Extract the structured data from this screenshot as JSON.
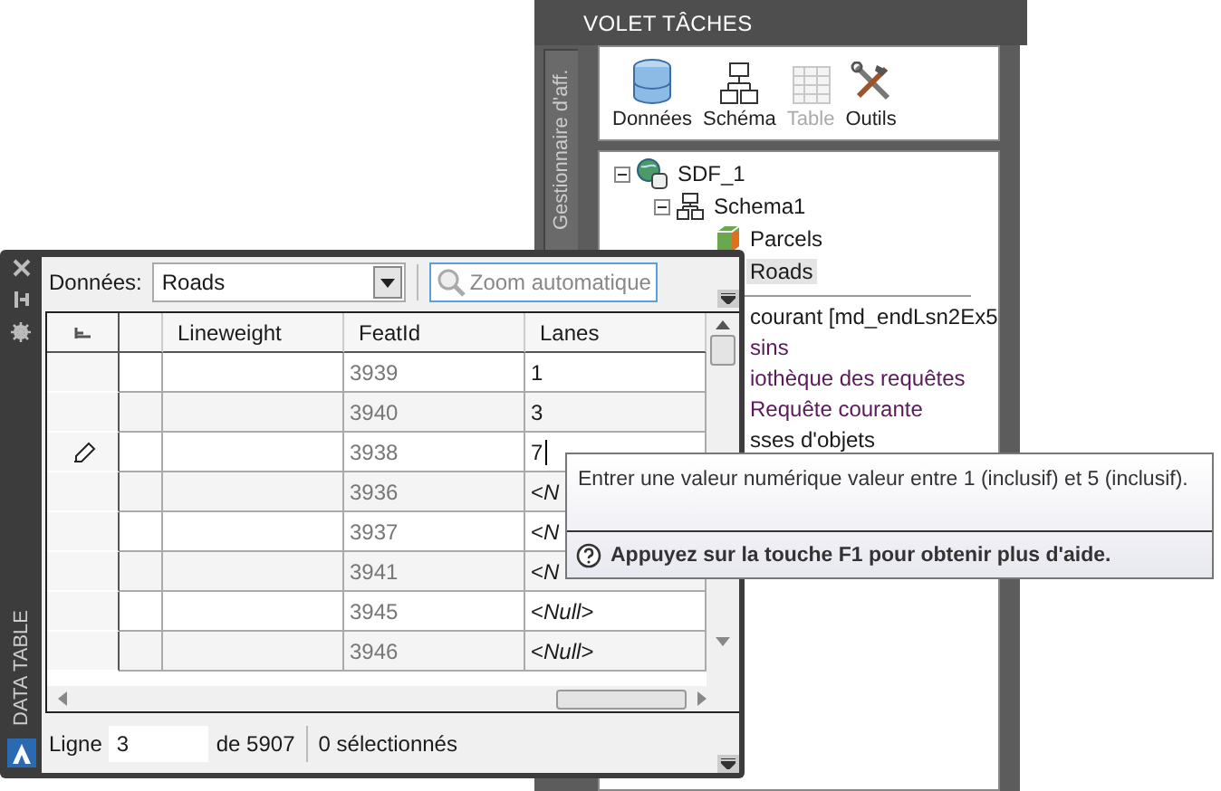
{
  "task_pane": {
    "title": "VOLET TÂCHES",
    "side_tab": "Gestionnaire d'aff.",
    "toolbar": [
      {
        "label": "Données",
        "kind": "database",
        "disabled": false
      },
      {
        "label": "Schéma",
        "kind": "schema",
        "disabled": false
      },
      {
        "label": "Table",
        "kind": "table",
        "disabled": true
      },
      {
        "label": "Outils",
        "kind": "tools",
        "disabled": false
      }
    ],
    "tree": [
      {
        "label": "SDF_1",
        "kind": "connection",
        "expanded": true,
        "selected": false,
        "children": [
          {
            "label": "Schema1",
            "kind": "schema",
            "expanded": true,
            "selected": false,
            "children": [
              {
                "label": "Parcels",
                "kind": "class",
                "selected": false
              },
              {
                "label": "Roads",
                "selected": true
              }
            ]
          }
        ]
      }
    ],
    "lower_items": [
      {
        "text": "courant [md_endLsn2Ex5",
        "color": "#1a1a1a"
      },
      {
        "text": "sins",
        "color": "#5a1a5a"
      },
      {
        "text": "iothèque des requêtes",
        "color": "#5a1a5a"
      },
      {
        "text": "Requête courante",
        "color": "#5a1a5a"
      },
      {
        "text": "sses d'objets",
        "color": "#1a1a1a"
      }
    ]
  },
  "data_table": {
    "side_label": "DATA TABLE",
    "data_label": "Données:",
    "data_value": "Roads",
    "zoom_button": "Zoom automatique",
    "columns": [
      "Lineweight",
      "FeatId",
      "Lanes"
    ],
    "rows": [
      {
        "featid": "3939",
        "lanes": "1",
        "editing": false
      },
      {
        "featid": "3940",
        "lanes": "3",
        "editing": false
      },
      {
        "featid": "3938",
        "lanes": "7",
        "editing": true
      },
      {
        "featid": "3936",
        "lanes": "<*N*",
        "editing": false
      },
      {
        "featid": "3937",
        "lanes": "<*N*",
        "editing": false
      },
      {
        "featid": "3941",
        "lanes": "<*N*",
        "editing": false
      },
      {
        "featid": "3945",
        "lanes": "<*Null*>",
        "editing": false
      },
      {
        "featid": "3946",
        "lanes": "<*Null*>",
        "editing": false
      }
    ],
    "status": {
      "row_label": "Ligne",
      "row_value": "3",
      "total": "de 5907",
      "selection": "0 sélectionnés"
    }
  },
  "tooltip": {
    "message": "Entrer une valeur numérique valeur entre 1 (inclusif) et 5 (inclusif).",
    "help": "Appuyez sur la touche F1 pour obtenir plus d'aide."
  }
}
